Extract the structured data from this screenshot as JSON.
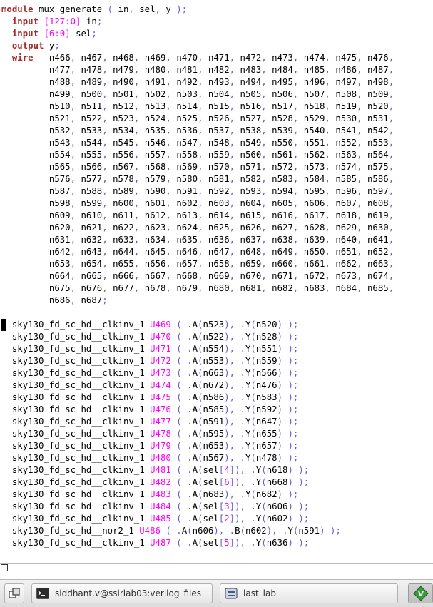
{
  "editor": {
    "header_lines": [
      [
        {
          "t": "module",
          "c": "kw"
        },
        {
          "t": " mux_generate "
        },
        {
          "t": "(",
          "c": "punc"
        },
        {
          "t": " in"
        },
        {
          "t": ",",
          "c": "punc"
        },
        {
          "t": " sel"
        },
        {
          "t": ",",
          "c": "punc"
        },
        {
          "t": " y "
        },
        {
          "t": ");",
          "c": "punc"
        }
      ],
      [
        {
          "t": "  "
        },
        {
          "t": "input",
          "c": "kw"
        },
        {
          "t": " "
        },
        {
          "t": "[127:0]",
          "c": "num"
        },
        {
          "t": " in"
        },
        {
          "t": ";",
          "c": "punc"
        }
      ],
      [
        {
          "t": "  "
        },
        {
          "t": "input",
          "c": "kw"
        },
        {
          "t": " "
        },
        {
          "t": "[6:0]",
          "c": "num"
        },
        {
          "t": " sel"
        },
        {
          "t": ";",
          "c": "punc"
        }
      ],
      [
        {
          "t": "  "
        },
        {
          "t": "output",
          "c": "kw"
        },
        {
          "t": " y"
        },
        {
          "t": ";",
          "c": "punc"
        }
      ],
      [
        {
          "t": "  "
        },
        {
          "t": "wire",
          "c": "kw"
        },
        {
          "t": "   n466"
        },
        {
          "t": ",",
          "c": "punc"
        },
        {
          "t": " n467"
        },
        {
          "t": ",",
          "c": "punc"
        },
        {
          "t": " n468"
        },
        {
          "t": ",",
          "c": "punc"
        },
        {
          "t": " n469"
        },
        {
          "t": ",",
          "c": "punc"
        },
        {
          "t": " n470"
        },
        {
          "t": ",",
          "c": "punc"
        },
        {
          "t": " n471"
        },
        {
          "t": ",",
          "c": "punc"
        },
        {
          "t": " n472"
        },
        {
          "t": ",",
          "c": "punc"
        },
        {
          "t": " n473"
        },
        {
          "t": ",",
          "c": "punc"
        },
        {
          "t": " n474"
        },
        {
          "t": ",",
          "c": "punc"
        },
        {
          "t": " n475"
        },
        {
          "t": ",",
          "c": "punc"
        },
        {
          "t": " n476"
        },
        {
          "t": ",",
          "c": "punc"
        }
      ]
    ],
    "wire_rows": [
      "n477, n478, n479, n480, n481, n482, n483, n484, n485, n486, n487,",
      "n488, n489, n490, n491, n492, n493, n494, n495, n496, n497, n498,",
      "n499, n500, n501, n502, n503, n504, n505, n506, n507, n508, n509,",
      "n510, n511, n512, n513, n514, n515, n516, n517, n518, n519, n520,",
      "n521, n522, n523, n524, n525, n526, n527, n528, n529, n530, n531,",
      "n532, n533, n534, n535, n536, n537, n538, n539, n540, n541, n542,",
      "n543, n544, n545, n546, n547, n548, n549, n550, n551, n552, n553,",
      "n554, n555, n556, n557, n558, n559, n560, n561, n562, n563, n564,",
      "n565, n566, n567, n568, n569, n570, n571, n572, n573, n574, n575,",
      "n576, n577, n578, n579, n580, n581, n582, n583, n584, n585, n586,",
      "n587, n588, n589, n590, n591, n592, n593, n594, n595, n596, n597,",
      "n598, n599, n600, n601, n602, n603, n604, n605, n606, n607, n608,",
      "n609, n610, n611, n612, n613, n614, n615, n616, n617, n618, n619,",
      "n620, n621, n622, n623, n624, n625, n626, n627, n628, n629, n630,",
      "n631, n632, n633, n634, n635, n636, n637, n638, n639, n640, n641,",
      "n642, n643, n644, n645, n646, n647, n648, n649, n650, n651, n652,",
      "n653, n654, n655, n656, n657, n658, n659, n660, n661, n662, n663,",
      "n664, n665, n666, n667, n668, n669, n670, n671, n672, n673, n674,",
      "n675, n676, n677, n678, n679, n680, n681, n682, n683, n684, n685,",
      "n686, n687;"
    ],
    "instances": [
      {
        "cell": "sky130_fd_sc_hd__clkinv_1",
        "name": "U469",
        "pins": [
          [
            "A",
            "n523"
          ],
          [
            "Y",
            "n520"
          ]
        ]
      },
      {
        "cell": "sky130_fd_sc_hd__clkinv_1",
        "name": "U470",
        "pins": [
          [
            "A",
            "n522"
          ],
          [
            "Y",
            "n528"
          ]
        ]
      },
      {
        "cell": "sky130_fd_sc_hd__clkinv_1",
        "name": "U471",
        "pins": [
          [
            "A",
            "n554"
          ],
          [
            "Y",
            "n551"
          ]
        ]
      },
      {
        "cell": "sky130_fd_sc_hd__clkinv_1",
        "name": "U472",
        "pins": [
          [
            "A",
            "n553"
          ],
          [
            "Y",
            "n559"
          ]
        ]
      },
      {
        "cell": "sky130_fd_sc_hd__clkinv_1",
        "name": "U473",
        "pins": [
          [
            "A",
            "n663"
          ],
          [
            "Y",
            "n566"
          ]
        ]
      },
      {
        "cell": "sky130_fd_sc_hd__clkinv_1",
        "name": "U474",
        "pins": [
          [
            "A",
            "n672"
          ],
          [
            "Y",
            "n476"
          ]
        ]
      },
      {
        "cell": "sky130_fd_sc_hd__clkinv_1",
        "name": "U475",
        "pins": [
          [
            "A",
            "n586"
          ],
          [
            "Y",
            "n583"
          ]
        ]
      },
      {
        "cell": "sky130_fd_sc_hd__clkinv_1",
        "name": "U476",
        "pins": [
          [
            "A",
            "n585"
          ],
          [
            "Y",
            "n592"
          ]
        ]
      },
      {
        "cell": "sky130_fd_sc_hd__clkinv_1",
        "name": "U477",
        "pins": [
          [
            "A",
            "n591"
          ],
          [
            "Y",
            "n647"
          ]
        ]
      },
      {
        "cell": "sky130_fd_sc_hd__clkinv_1",
        "name": "U478",
        "pins": [
          [
            "A",
            "n595"
          ],
          [
            "Y",
            "n655"
          ]
        ]
      },
      {
        "cell": "sky130_fd_sc_hd__clkinv_1",
        "name": "U479",
        "pins": [
          [
            "A",
            "n653"
          ],
          [
            "Y",
            "n657"
          ]
        ]
      },
      {
        "cell": "sky130_fd_sc_hd__clkinv_1",
        "name": "U480",
        "pins": [
          [
            "A",
            "n567"
          ],
          [
            "Y",
            "n478"
          ]
        ]
      },
      {
        "cell": "sky130_fd_sc_hd__clkinv_1",
        "name": "U481",
        "pins": [
          [
            "A",
            "sel",
            "4"
          ],
          [
            "Y",
            "n618"
          ]
        ]
      },
      {
        "cell": "sky130_fd_sc_hd__clkinv_1",
        "name": "U482",
        "pins": [
          [
            "A",
            "sel",
            "6"
          ],
          [
            "Y",
            "n668"
          ]
        ]
      },
      {
        "cell": "sky130_fd_sc_hd__clkinv_1",
        "name": "U483",
        "pins": [
          [
            "A",
            "n683"
          ],
          [
            "Y",
            "n682"
          ]
        ]
      },
      {
        "cell": "sky130_fd_sc_hd__clkinv_1",
        "name": "U484",
        "pins": [
          [
            "A",
            "sel",
            "3"
          ],
          [
            "Y",
            "n606"
          ]
        ]
      },
      {
        "cell": "sky130_fd_sc_hd__clkinv_1",
        "name": "U485",
        "pins": [
          [
            "A",
            "sel",
            "2"
          ],
          [
            "Y",
            "n602"
          ]
        ]
      },
      {
        "cell": "sky130_fd_sc_hd__nor2_1",
        "name": "U486",
        "pins": [
          [
            "A",
            "n606"
          ],
          [
            "B",
            "n602"
          ],
          [
            "Y",
            "n591"
          ]
        ]
      },
      {
        "cell": "sky130_fd_sc_hd__clkinv_1",
        "name": "U487",
        "pins": [
          [
            "A",
            "sel",
            "5"
          ],
          [
            "Y",
            "n636"
          ]
        ]
      }
    ],
    "colors": {
      "keyword": "#a52a2a",
      "number": "#ff00ff",
      "punctuation": "#6a5acd",
      "text": "#000000",
      "background": "#ffffff"
    }
  },
  "taskbar": {
    "show_desktop_icon": "show-desktop-icon",
    "tasks": [
      {
        "label": "siddhant.v@ssirlab03:verilog_files",
        "icon": "terminal-icon"
      },
      {
        "label": "last_lab",
        "icon": "file-manager-icon"
      },
      {
        "label": "",
        "icon": "vim-icon"
      }
    ]
  }
}
